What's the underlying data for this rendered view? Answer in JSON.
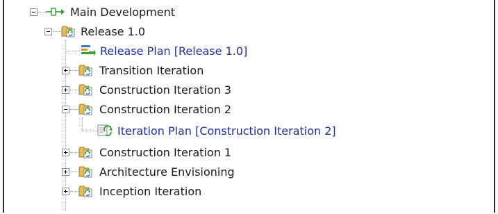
{
  "tree": {
    "root": {
      "label": "Main Development",
      "icon": "timeline-icon"
    },
    "release": {
      "label": "Release 1.0",
      "icon": "folder-iteration-icon"
    },
    "release_plan": {
      "label": "Release Plan [Release 1.0]",
      "icon": "release-plan-icon"
    },
    "iterations": [
      {
        "label": "Transition Iteration",
        "expanded": false
      },
      {
        "label": "Construction Iteration 3",
        "expanded": false
      },
      {
        "label": "Construction Iteration 2",
        "expanded": true
      },
      {
        "label": "Construction Iteration 1",
        "expanded": false
      },
      {
        "label": "Architecture Envisioning",
        "expanded": false
      },
      {
        "label": "Inception Iteration",
        "expanded": false
      }
    ],
    "iteration_plan": {
      "label": "Iteration Plan [Construction Iteration 2]",
      "icon": "iteration-plan-icon"
    }
  },
  "colors": {
    "link": "#1c2fa0",
    "folder": "#e2b646",
    "arrow": "#4aa93a"
  }
}
